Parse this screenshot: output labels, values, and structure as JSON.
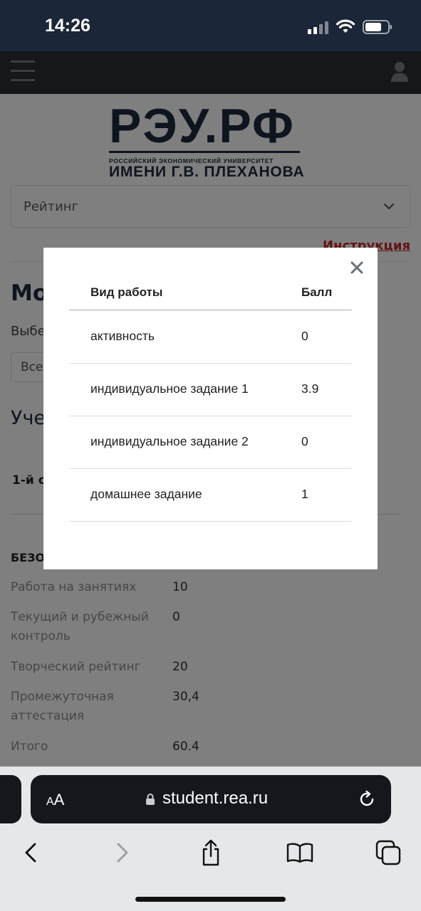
{
  "status_bar": {
    "time": "14:26"
  },
  "page": {
    "logo": {
      "main": "РЭУ.РФ",
      "sub1": "РОССИЙСКИЙ ЭКОНОМИЧЕСКИЙ УНИВЕРСИТЕТ",
      "sub2": "ИМЕНИ Г.В. ПЛЕХАНОВА"
    },
    "rating_select": {
      "value": "Рейтинг"
    },
    "instruction_link": "Инструкция",
    "heading": "Мо",
    "select_hint": "Выбе",
    "small_select_value": "Все",
    "section_title": "Уче",
    "semester": "1-й с",
    "subject": "БЕЗО",
    "scores": [
      {
        "label": "Работа на занятиях",
        "value": "10"
      },
      {
        "label": "Текущий и рубежный контроль",
        "value": "0"
      },
      {
        "label": "Творческий рейтинг",
        "value": "20"
      },
      {
        "label": "Промежуточная аттестация",
        "value": "30,4"
      },
      {
        "label": "Итого",
        "value": "60.4"
      }
    ]
  },
  "modal": {
    "columns": {
      "type": "Вид работы",
      "score": "Балл"
    },
    "rows": [
      {
        "type": "активность",
        "score": "0"
      },
      {
        "type": "индивидуальное задание 1",
        "score": "3.9"
      },
      {
        "type": "индивидуальное задание 2",
        "score": "0"
      },
      {
        "type": "домашнее задание",
        "score": "1"
      }
    ]
  },
  "browser": {
    "aa_small": "A",
    "aa_big": "A",
    "url": "student.rea.ru"
  },
  "colors": {
    "status_bar_bg": "#1b2638",
    "header_bg": "#2b2e33",
    "brand_navy": "#1e2a3e",
    "link_red": "#c62828",
    "url_pill_bg": "#14171c"
  },
  "icons": [
    "signal-icon",
    "wifi-icon",
    "battery-icon",
    "menu-icon",
    "user-icon",
    "chevron-down-icon",
    "close-icon",
    "lock-icon",
    "reload-icon",
    "back-icon",
    "forward-icon",
    "share-icon",
    "bookmarks-icon",
    "tabs-icon"
  ]
}
